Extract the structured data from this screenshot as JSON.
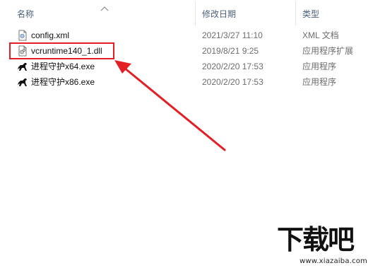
{
  "columns": {
    "name": "名称",
    "date": "修改日期",
    "type": "类型"
  },
  "files": [
    {
      "name": "config.xml",
      "date": "2021/3/27 11:10",
      "type": "XML 文档",
      "icon": "xml-file-icon"
    },
    {
      "name": "vcruntime140_1.dll",
      "date": "2019/8/21 9:25",
      "type": "应用程序扩展",
      "icon": "dll-file-icon"
    },
    {
      "name": "进程守护x64.exe",
      "date": "2020/2/20 17:53",
      "type": "应用程序",
      "icon": "horse-app-icon"
    },
    {
      "name": "进程守护x86.exe",
      "date": "2020/2/20 17:53",
      "type": "应用程序",
      "icon": "horse-app-icon"
    }
  ],
  "annotation": {
    "color": "#e31e24"
  },
  "watermark": {
    "title": "下载吧",
    "url": "www.xiazaiba.com"
  }
}
